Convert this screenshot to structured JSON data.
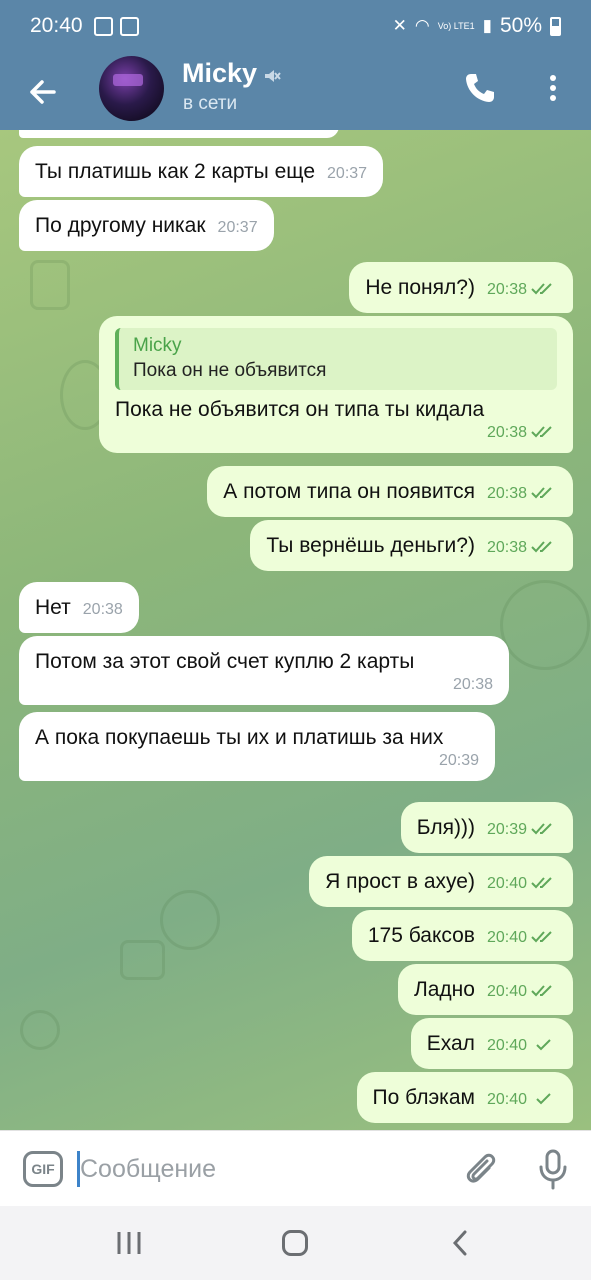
{
  "status_bar": {
    "time": "20:40",
    "network": "Vo) LTE1",
    "battery": "50%"
  },
  "header": {
    "name": "Micky",
    "status": "в сети"
  },
  "messages": [
    {
      "text": "Ты платишь как 2 карты еще",
      "time": "20:37"
    },
    {
      "text": "По другому никак",
      "time": "20:37"
    },
    {
      "text": "Не понял?)",
      "time": "20:38"
    },
    {
      "reply_name": "Micky",
      "reply_text": "Пока он не объявится",
      "text": "Пока не объявится он типа ты кидала",
      "time": "20:38"
    },
    {
      "text": "А потом типа он появится",
      "time": "20:38"
    },
    {
      "text": "Ты вернёшь деньги?)",
      "time": "20:38"
    },
    {
      "text": "Нет",
      "time": "20:38"
    },
    {
      "text": "Потом за этот свой счет куплю 2 карты",
      "time": "20:38"
    },
    {
      "text": "А пока покупаешь ты их и платишь за них",
      "time": "20:39"
    },
    {
      "text": "Бля)))",
      "time": "20:39"
    },
    {
      "text": "Я прост в ахуе)",
      "time": "20:40"
    },
    {
      "text": "175 баксов",
      "time": "20:40"
    },
    {
      "text": "Ладно",
      "time": "20:40"
    },
    {
      "text": "Ехал",
      "time": "20:40"
    },
    {
      "text": "По блэкам",
      "time": "20:40"
    }
  ],
  "composer": {
    "gif_label": "GIF",
    "placeholder": "Сообщение"
  },
  "colors": {
    "header": "#5b86a8",
    "outgoing_bubble": "#eefed9",
    "incoming_bubble": "#ffffff",
    "accent_green": "#5fa85a"
  }
}
